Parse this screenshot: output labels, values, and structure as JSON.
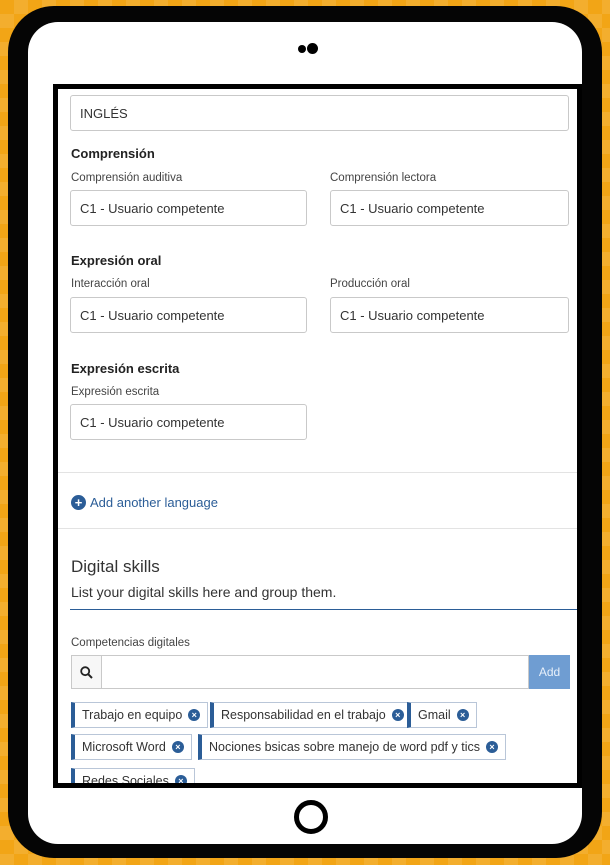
{
  "language": {
    "name": "INGLÉS",
    "sections": {
      "comprension": {
        "title": "Comprensión",
        "auditiva_label": "Comprensión auditiva",
        "auditiva_value": "C1 - Usuario competente",
        "lectora_label": "Comprensión lectora",
        "lectora_value": "C1 - Usuario competente"
      },
      "expresion_oral": {
        "title": "Expresión oral",
        "interaccion_label": "Interacción oral",
        "interaccion_value": "C1 - Usuario competente",
        "produccion_label": "Producción oral",
        "produccion_value": "C1 - Usuario competente"
      },
      "expresion_escrita": {
        "title": "Expresión escrita",
        "escrita_label": "Expresión escrita",
        "escrita_value": "C1 - Usuario competente"
      }
    },
    "add_another": "Add another language"
  },
  "digital_skills": {
    "title": "Digital skills",
    "subtitle": "List your digital skills here and group them.",
    "group_label": "Competencias digitales",
    "search_value": "",
    "add_label": "Add",
    "skills": [
      "Trabajo en equipo",
      "Responsabilidad en el trabajo",
      "Gmail",
      "Microsoft Word",
      "Nociones bsicas sobre manejo de word pdf y tics",
      "Redes Sociales"
    ]
  },
  "colors": {
    "background": "#f2a516",
    "accent": "#2b5d97",
    "add_button": "#6f9dd2"
  }
}
